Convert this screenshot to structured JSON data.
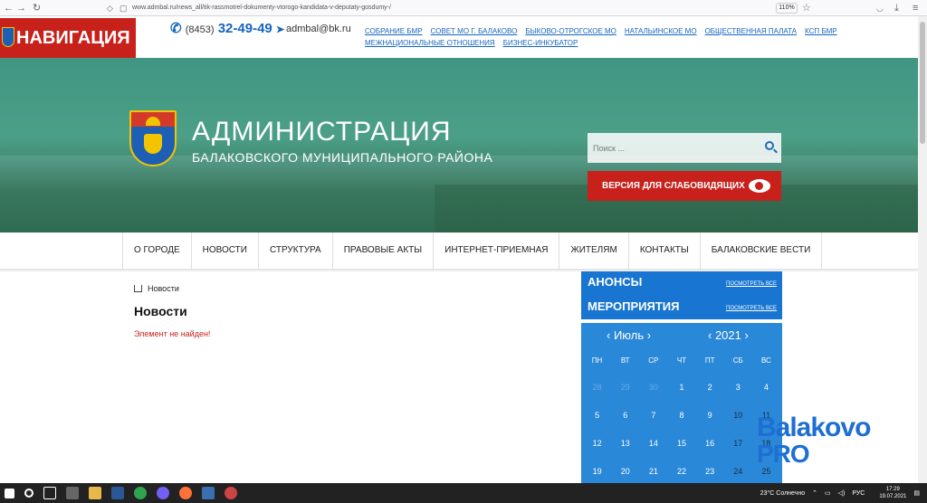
{
  "browser": {
    "url": "www.admbal.ru/news_all/tik-rassmotrel-dokumenty-vtorogo-kandidata-v-deputaty-gosdumy-/",
    "zoom": "110%"
  },
  "topbar": {
    "nav_label": "НАВИГАЦИЯ",
    "phone_code": "(8453)",
    "phone": "32-49-49",
    "email": "admbal@bk.ru",
    "links": [
      "СОБРАНИЕ БМР",
      "СОВЕТ МО Г. БАЛАКОВО",
      "БЫКОВО-ОТРОГСКОЕ МО",
      "НАТАЛЬИНСКОЕ МО",
      "ОБЩЕСТВЕННАЯ ПАЛАТА",
      "КСП БМР",
      "МЕЖНАЦИОНАЛЬНЫЕ ОТНОШЕНИЯ",
      "БИЗНЕС-ИНКУБАТОР"
    ]
  },
  "header": {
    "title": "АДМИНИСТРАЦИЯ",
    "subtitle": "БАЛАКОВСКОГО МУНИЦИПАЛЬНОГО РАЙОНА",
    "search_placeholder": "Поиск ...",
    "vision_button": "ВЕРСИЯ ДЛЯ СЛАБОВИДЯЩИХ"
  },
  "menu": [
    "О ГОРОДЕ",
    "НОВОСТИ",
    "СТРУКТУРА",
    "ПРАВОВЫЕ АКТЫ",
    "ИНТЕРНЕТ-ПРИЕМНАЯ",
    "ЖИТЕЛЯМ",
    "КОНТАКТЫ",
    "БАЛАКОВСКИЕ ВЕСТИ"
  ],
  "main": {
    "breadcrumb": "Новости",
    "heading": "Новости",
    "error": "Элемент не найден!"
  },
  "sidebar": {
    "anons": "АНОНСЫ",
    "events": "МЕРОПРИЯТИЯ",
    "see_all": "ПОСМОТРЕТЬ ВСЕ",
    "calendar": {
      "month": "‹ Июль ›",
      "year": "‹ 2021 ›",
      "weekdays": [
        "ПН",
        "ВТ",
        "СР",
        "ЧТ",
        "ПТ",
        "СБ",
        "ВС"
      ],
      "days": [
        "28",
        "29",
        "30",
        "1",
        "2",
        "3",
        "4",
        "5",
        "6",
        "7",
        "8",
        "9",
        "10",
        "11",
        "12",
        "13",
        "14",
        "15",
        "16",
        "17",
        "18",
        "19",
        "20",
        "21",
        "22",
        "23",
        "24",
        "25"
      ]
    }
  },
  "watermark": {
    "line1": "Balakovo",
    "line2": "PRO"
  },
  "taskbar": {
    "weather": "23°C Солнечно",
    "lang": "РУС",
    "time": "17:29",
    "date": "19.07.2021"
  }
}
